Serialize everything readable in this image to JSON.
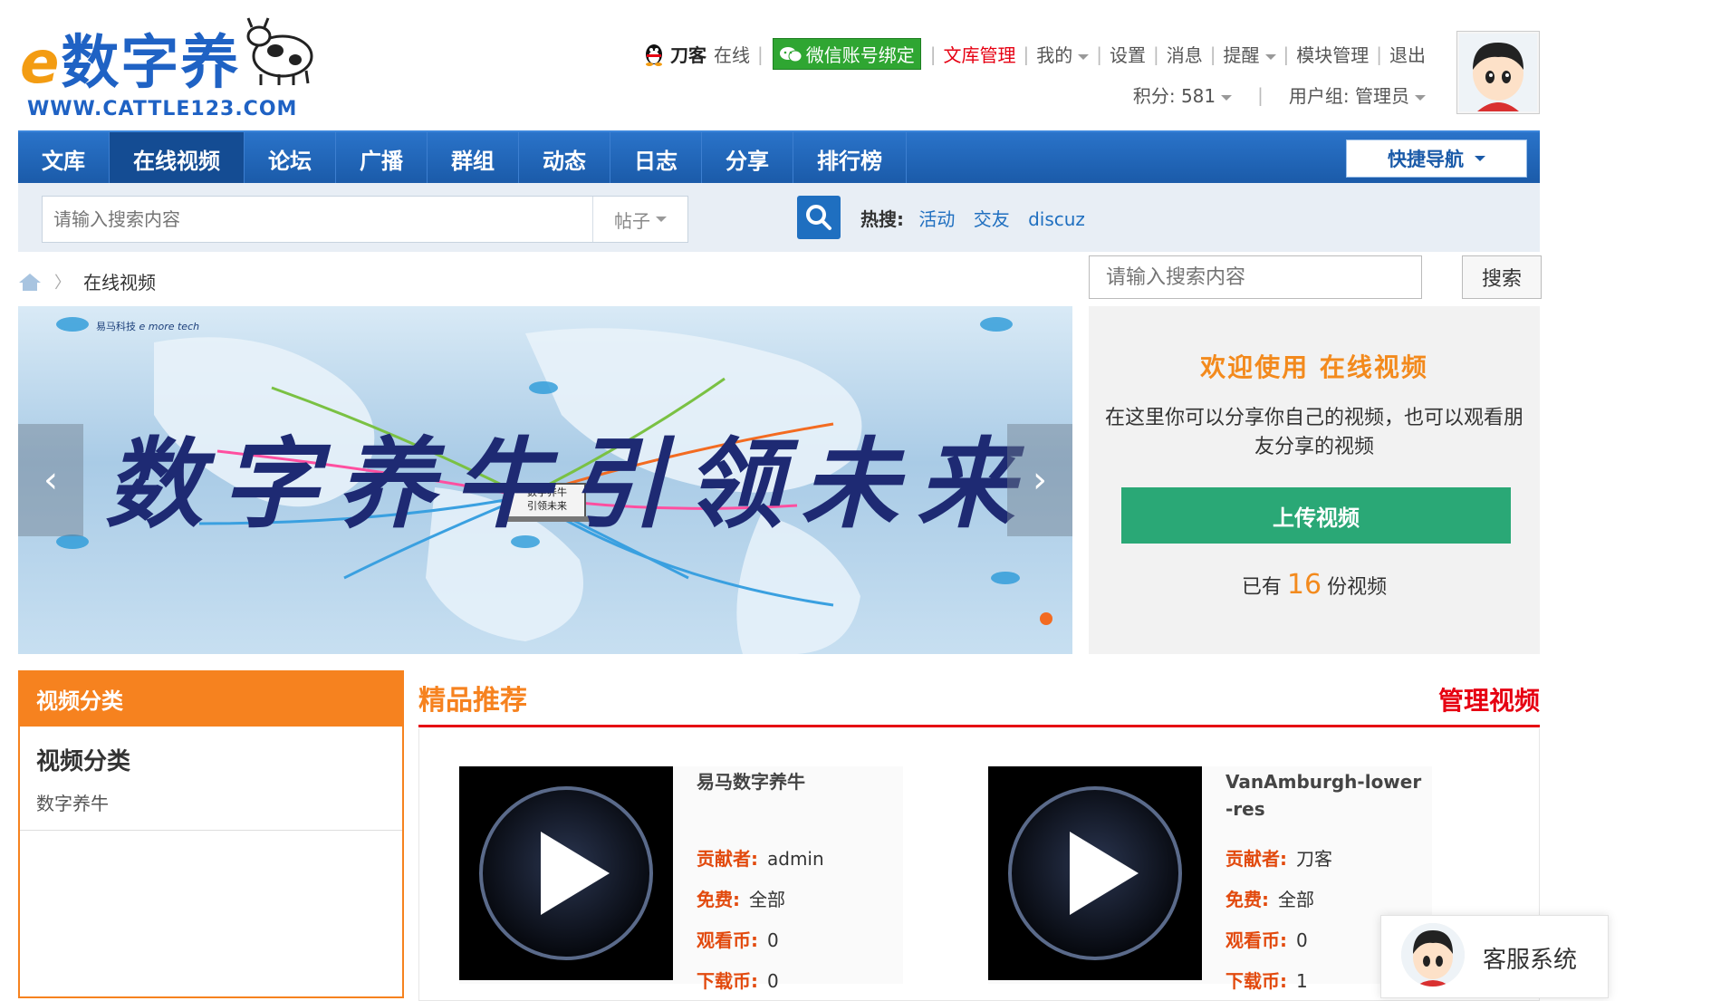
{
  "logo": {
    "text_cn": "数字养",
    "url": "WWW.CATTLE123.COM"
  },
  "user": {
    "name": "刀客",
    "status": "在线",
    "wechat_bind": "微信账号绑定",
    "links": [
      "文库管理",
      "我的",
      "设置",
      "消息",
      "提醒",
      "模块管理",
      "退出"
    ],
    "points": "积分: 581",
    "group": "用户组: 管理员"
  },
  "nav": {
    "items": [
      "文库",
      "在线视频",
      "论坛",
      "广播",
      "群组",
      "动态",
      "日志",
      "分享",
      "排行榜"
    ],
    "active": "在线视频",
    "quicknav": "快捷导航"
  },
  "search": {
    "placeholder": "请输入搜索内容",
    "type": "帖子",
    "hot_label": "热搜:",
    "hot_items": [
      "活动",
      "交友",
      "discuz"
    ]
  },
  "breadcrumb": {
    "current": "在线视频"
  },
  "side_search": {
    "placeholder": "请输入搜索内容",
    "button": "搜索"
  },
  "banner": {
    "slogan": "数字养牛引领未来",
    "center_label_1": "数字养牛",
    "center_label_2": "引领未来",
    "brand": "易马科技",
    "brand_sub": "e more tech"
  },
  "welcome": {
    "title": "欢迎使用 在线视频",
    "desc": "在这里你可以分享你自己的视频，也可以观看朋友分享的视频",
    "upload": "上传视频",
    "count_prefix": "已有",
    "count": "16",
    "count_suffix": "份视频"
  },
  "category": {
    "header": "视频分类",
    "title": "视频分类",
    "items": [
      "数字养牛"
    ]
  },
  "featured": {
    "title": "精品推荐",
    "manage": "管理视频",
    "labels": {
      "contributor": "贡献者:",
      "fee": "免费:",
      "watch": "观看币:",
      "download": "下载币:"
    },
    "videos": [
      {
        "title": "易马数字养牛",
        "contributor": "admin",
        "fee": "全部",
        "watch": "0",
        "download": "0"
      },
      {
        "title": "VanAmburgh-lower-res",
        "contributor": "刀客",
        "fee": "全部",
        "watch": "0",
        "download": "1"
      }
    ]
  },
  "service": {
    "label": "客服系统"
  },
  "colors": {
    "nav_blue": "#1a5aa8",
    "orange": "#f6821f",
    "red": "#e60012",
    "green": "#2aa876",
    "wechat_green": "#2fa632"
  }
}
